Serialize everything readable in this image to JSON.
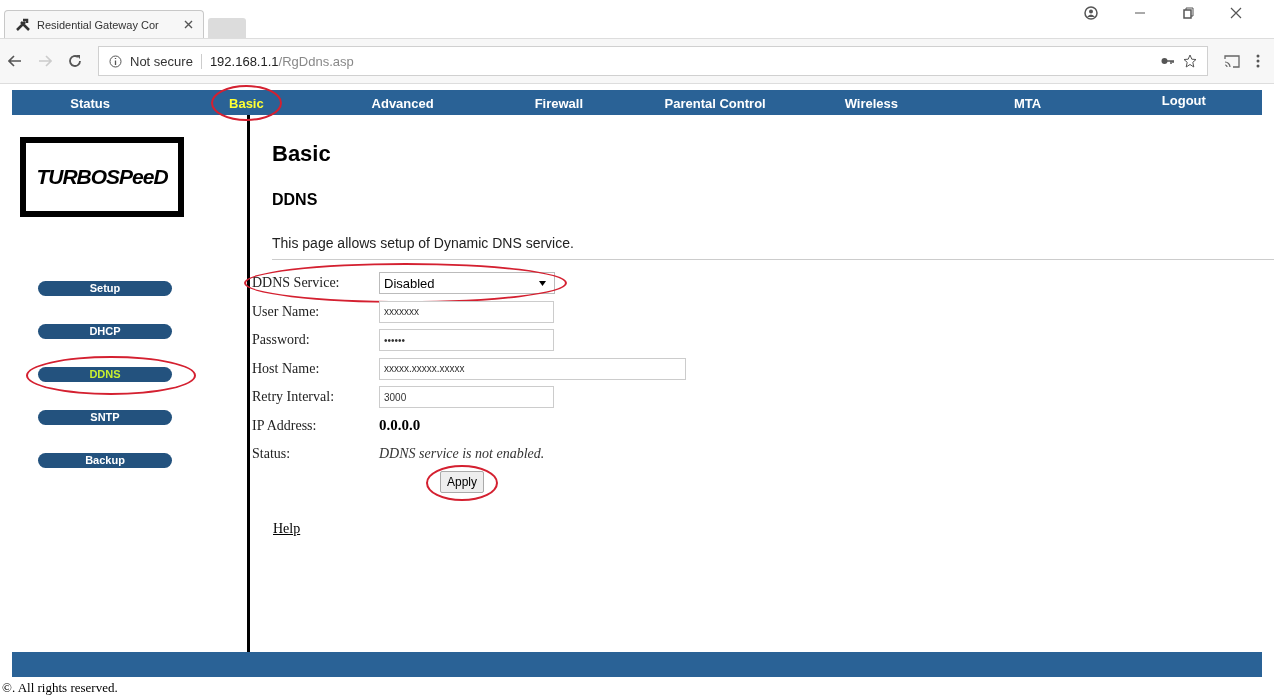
{
  "browser": {
    "tab_title": "Residential Gateway Cor",
    "security": "Not secure",
    "url_host": "192.168.1.1",
    "url_path": "/RgDdns.asp"
  },
  "nav": [
    {
      "label": "Status",
      "selected": false,
      "circled": false
    },
    {
      "label": "Basic",
      "selected": true,
      "circled": true
    },
    {
      "label": "Advanced",
      "selected": false,
      "circled": false
    },
    {
      "label": "Firewall",
      "selected": false,
      "circled": false
    },
    {
      "label": "Parental Control",
      "selected": false,
      "circled": false
    },
    {
      "label": "Wireless",
      "selected": false,
      "circled": false
    },
    {
      "label": "MTA",
      "selected": false,
      "circled": false
    },
    {
      "label": "Logout",
      "selected": false,
      "circled": false
    }
  ],
  "logo": "TURBOSPeeD",
  "sidebar": [
    {
      "label": "Setup",
      "selected": false,
      "circled": false
    },
    {
      "label": "DHCP",
      "selected": false,
      "circled": false
    },
    {
      "label": "DDNS",
      "selected": true,
      "circled": true
    },
    {
      "label": "SNTP",
      "selected": false,
      "circled": false
    },
    {
      "label": "Backup",
      "selected": false,
      "circled": false
    }
  ],
  "title": "Basic",
  "subtitle": "DDNS",
  "description": "This page allows setup of Dynamic DNS service.",
  "form": [
    {
      "kind": "select",
      "label": "DDNS Service:",
      "value": "Disabled",
      "circled": true
    },
    {
      "kind": "text",
      "label": "User Name:",
      "value": "xxxxxxx",
      "circled": false
    },
    {
      "kind": "text",
      "label": "Password:",
      "value": "••••••",
      "circled": false
    },
    {
      "kind": "wide",
      "label": "Host Name:",
      "value": "xxxxx.xxxxx.xxxxx",
      "circled": false
    },
    {
      "kind": "text",
      "label": "Retry Interval:",
      "value": "3000",
      "circled": false
    },
    {
      "kind": "static",
      "label": "IP Address:",
      "value": "0.0.0.0",
      "circled": false
    },
    {
      "kind": "status",
      "label": "Status:",
      "value": "DDNS service is not enabled.",
      "circled": false
    }
  ],
  "apply": {
    "label": "Apply",
    "circled": true
  },
  "help": "Help",
  "footer": "©. All rights reserved."
}
